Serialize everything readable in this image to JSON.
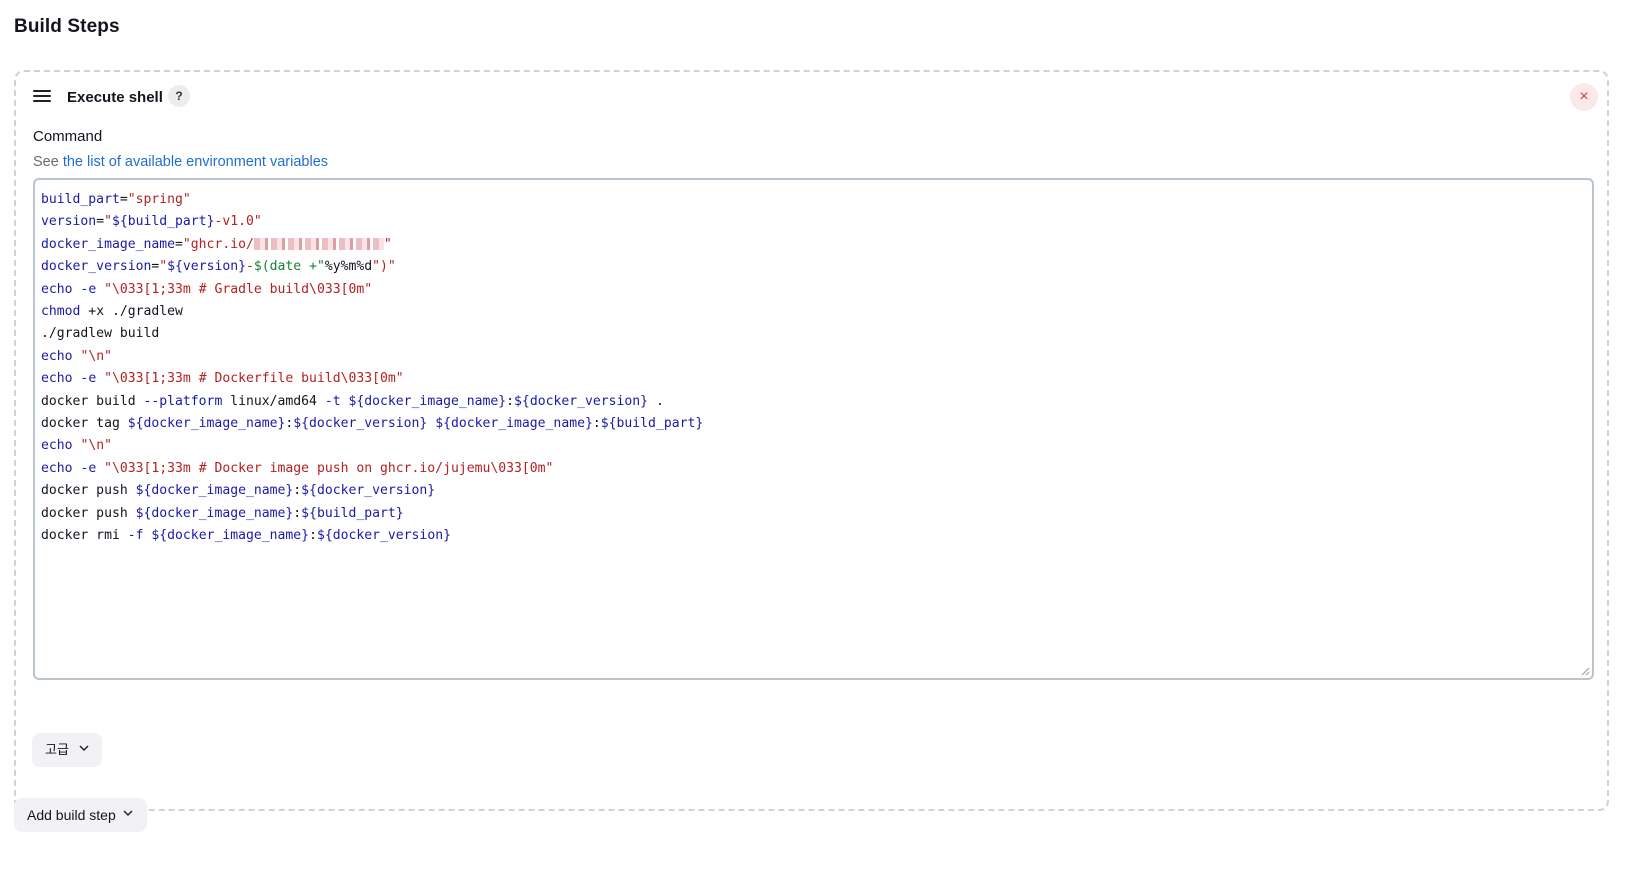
{
  "section": {
    "title": "Build Steps"
  },
  "step": {
    "title": "Execute shell",
    "help_label": "?",
    "close_label": "×",
    "field_label": "Command",
    "desc_prefix": "See ",
    "desc_link": "the list of available environment variables",
    "code_lines": [
      "build_part=\"spring\"",
      "version=\"${build_part}-v1.0\"",
      "docker_image_name=\"ghcr.io/[redacted]\"",
      "docker_version=\"${version}-$(date +\"%y%m%d\")\"",
      "",
      "echo -e \"\\033[1;33m # Gradle build\\033[0m\"",
      "chmod +x ./gradlew",
      "./gradlew build",
      "",
      "echo \"\\n\"",
      "echo -e \"\\033[1;33m # Dockerfile build\\033[0m\"",
      "docker build --platform linux/amd64 -t ${docker_image_name}:${docker_version} .",
      "docker tag ${docker_image_name}:${docker_version} ${docker_image_name}:${build_part}",
      "",
      "echo \"\\n\"",
      "echo -e \"\\033[1;33m # Docker image push on ghcr.io/jujemu\\033[0m\"",
      "docker push ${docker_image_name}:${docker_version}",
      "docker push ${docker_image_name}:${build_part}",
      "docker rmi -f ${docker_image_name}:${docker_version}"
    ],
    "advanced_label": "고급"
  },
  "add_step": {
    "label": "Add build step"
  },
  "colors": {
    "link": "#1f6fd1",
    "close": "#e0343f",
    "variable": "#1a1aa6",
    "string": "#b22222"
  }
}
